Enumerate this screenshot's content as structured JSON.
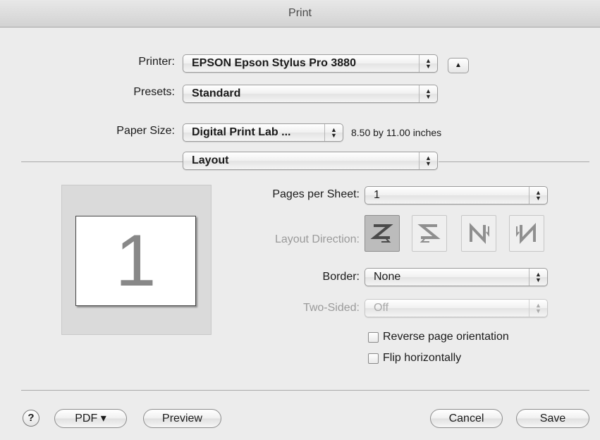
{
  "window": {
    "title": "Print"
  },
  "printer": {
    "label": "Printer:",
    "value": "EPSON Epson Stylus Pro 3880"
  },
  "presets": {
    "label": "Presets:",
    "value": "Standard"
  },
  "paper_size": {
    "label": "Paper Size:",
    "value": "Digital Print Lab ...",
    "dimensions": "8.50 by 11.00 inches"
  },
  "section": {
    "value": "Layout"
  },
  "preview": {
    "page_number": "1"
  },
  "layout": {
    "pages_per_sheet": {
      "label": "Pages per Sheet:",
      "value": "1"
    },
    "layout_direction": {
      "label": "Layout Direction:",
      "icons": [
        "z-left-right-icon",
        "s-reverse-icon",
        "n-down-icon",
        "n-reverse-icon"
      ]
    },
    "border": {
      "label": "Border:",
      "value": "None"
    },
    "two_sided": {
      "label": "Two-Sided:",
      "value": "Off"
    },
    "reverse_orientation": {
      "label": "Reverse page orientation",
      "checked": false
    },
    "flip_horizontally": {
      "label": "Flip horizontally",
      "checked": false
    }
  },
  "footer": {
    "help_label": "?",
    "pdf_label": "PDF ▾",
    "preview_label": "Preview",
    "cancel_label": "Cancel",
    "save_label": "Save"
  }
}
